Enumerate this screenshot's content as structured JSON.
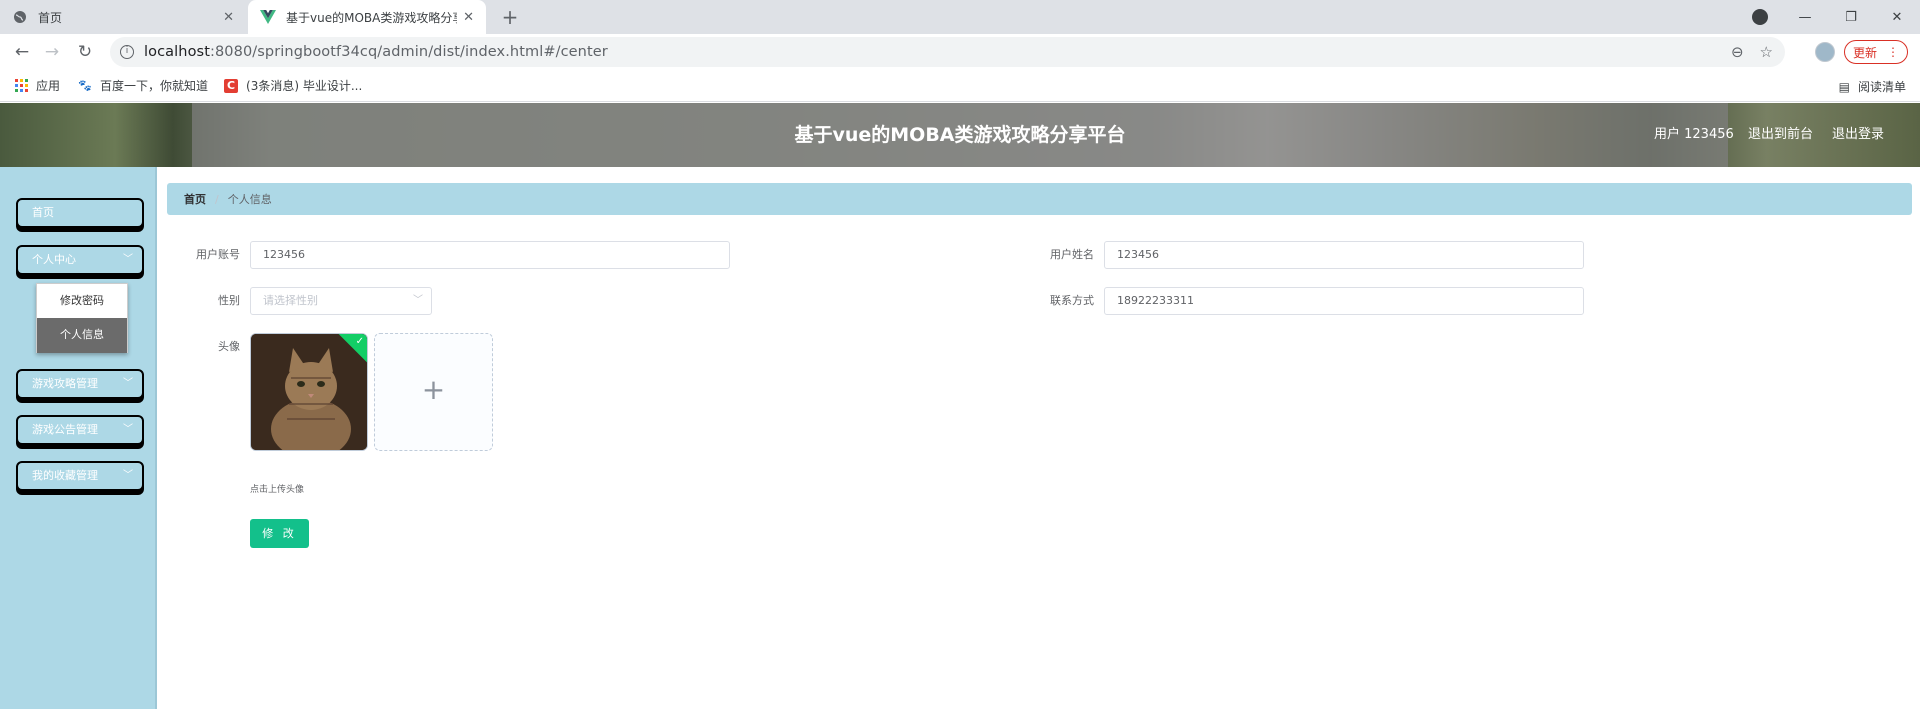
{
  "browser": {
    "tabs": [
      {
        "title": "首页",
        "active": false
      },
      {
        "title": "基于vue的MOBA类游戏攻略分享",
        "active": true
      }
    ],
    "url_host": "localhost",
    "url_rest": ":8080/springbootf34cq/admin/dist/index.html#/center",
    "update_label": "更新",
    "bookmarks": [
      "应用",
      "百度一下，你就知道",
      "(3条消息) 毕业设计..."
    ],
    "reading_list": "阅读清单"
  },
  "header": {
    "title": "基于vue的MOBA类游戏攻略分享平台",
    "user": "用户 123456",
    "links": [
      "退出到前台",
      "退出登录"
    ]
  },
  "sidebar": {
    "items": [
      "首页",
      "个人中心",
      "游戏攻略管理",
      "游戏公告管理",
      "我的收藏管理"
    ],
    "submenu": [
      "修改密码",
      "个人信息"
    ]
  },
  "breadcrumb": {
    "home": "首页",
    "sep": "/",
    "current": "个人信息"
  },
  "form": {
    "account_label": "用户账号",
    "account_value": "123456",
    "name_label": "用户姓名",
    "name_value": "123456",
    "gender_label": "性别",
    "gender_placeholder": "请选择性别",
    "phone_label": "联系方式",
    "phone_value": "18922233311",
    "avatar_label": "头像",
    "upload_tip": "点击上传头像",
    "submit_label": "修 改"
  },
  "colors": {
    "sidebar_bg": "#add8e6",
    "accent_green": "#13c08b",
    "success_badge": "#13ce66"
  }
}
